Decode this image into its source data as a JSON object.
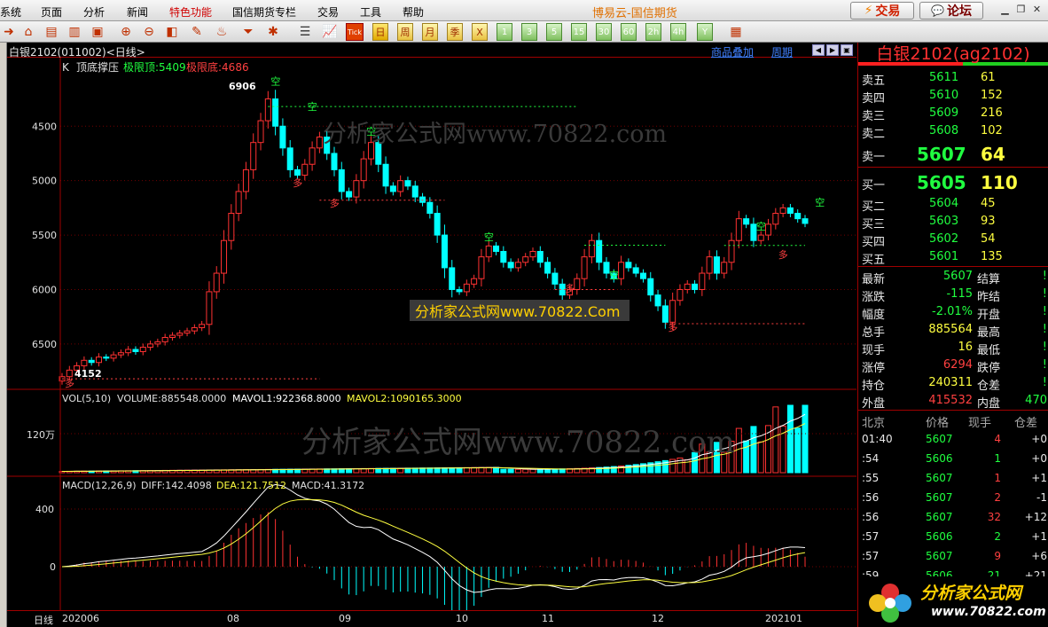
{
  "menubar": {
    "items": [
      {
        "label": "系统",
        "red": false
      },
      {
        "label": "页面",
        "red": false
      },
      {
        "label": "分析",
        "red": false
      },
      {
        "label": "新闻",
        "red": false
      },
      {
        "label": "特色功能",
        "red": true
      },
      {
        "label": "国信期货专栏",
        "red": false
      },
      {
        "label": "交易",
        "red": false
      },
      {
        "label": "工具",
        "red": false
      },
      {
        "label": "帮助",
        "red": false
      }
    ],
    "app_title": "博易云-国信期货",
    "trade_button": "交易",
    "forum_button": "论坛"
  },
  "toolbar": {
    "periods": [
      "日",
      "周",
      "月",
      "季",
      "X"
    ],
    "minutes": [
      "1",
      "3",
      "5",
      "15",
      "30",
      "60",
      "2h",
      "4h",
      "Y"
    ],
    "tick_label": "Tick"
  },
  "chart_header": {
    "title": "白银2102(011002)<日线>",
    "overlay_link": "商品叠加",
    "period_link": "周期"
  },
  "main_panel": {
    "indicator_name": "K",
    "indicator_label": "顶底撑压",
    "top_label": "极限顶:5409",
    "bottom_label": "极限底:4686",
    "high_label": "6906",
    "low_label": "4152",
    "watermark_1": "分析家公式网www.70822.com",
    "watermark_box": "分析家公式网www.70822.Com",
    "y_ticks": [
      "6500",
      "6000",
      "5500",
      "5000",
      "4500"
    ],
    "mark_kong": "空",
    "mark_duo": "多"
  },
  "volume_panel": {
    "title": "VOL(5,10)",
    "volume": "VOLUME:885548.0000",
    "mavol1": "MAVOL1:922368.8000",
    "mavol2": "MAVOL2:1090165.3000",
    "y_tick": "120万",
    "watermark": "分析家公式网www.70822.com"
  },
  "macd_panel": {
    "title": "MACD(12,26,9)",
    "diff": "DIFF:142.4098",
    "dea": "DEA:121.7512",
    "macd": "MACD:41.3172",
    "y_ticks": [
      "400",
      "0"
    ]
  },
  "x_axis": {
    "period_label": "日线",
    "labels": [
      "202006",
      "08",
      "09",
      "10",
      "11",
      "12",
      "202101"
    ]
  },
  "chart_data": {
    "type": "candlestick",
    "y_range": [
      4100,
      6950
    ],
    "x_labels": [
      "202006",
      "08",
      "09",
      "10",
      "11",
      "12",
      "202101"
    ],
    "key_levels": {
      "high": 6906,
      "low": 4152,
      "extreme_top": 5409,
      "extreme_bottom": 4686
    },
    "y_ticks": [
      4500,
      5000,
      5500,
      6000,
      6500
    ],
    "close_approx": [
      4200,
      4260,
      4300,
      4350,
      4330,
      4380,
      4370,
      4400,
      4420,
      4450,
      4430,
      4470,
      4500,
      4520,
      4560,
      4580,
      4600,
      4620,
      4650,
      4680,
      4980,
      5150,
      5450,
      5700,
      5900,
      6100,
      6350,
      6550,
      6750,
      6500,
      6300,
      6100,
      6050,
      6150,
      6300,
      6400,
      6250,
      6100,
      5900,
      5850,
      6000,
      6200,
      6350,
      6150,
      5950,
      5900,
      6000,
      5950,
      5850,
      5800,
      5700,
      5500,
      5200,
      5000,
      4980,
      5050,
      5100,
      5300,
      5400,
      5350,
      5250,
      5200,
      5250,
      5300,
      5350,
      5250,
      5150,
      5050,
      4950,
      5000,
      5100,
      5300,
      5450,
      5250,
      5150,
      5100,
      5250,
      5200,
      5150,
      5100,
      4950,
      4850,
      4700,
      4900,
      5000,
      5050,
      5000,
      5150,
      5300,
      5150,
      5250,
      5450,
      5650,
      5600,
      5450,
      5500,
      5600,
      5700,
      5750,
      5700,
      5650,
      5607
    ],
    "volume_label": "VOLUME:885548.0000",
    "macd": {
      "diff": 142.4098,
      "dea": 121.7512,
      "macd": 41.3172,
      "y_ticks": [
        0,
        400
      ]
    }
  },
  "quote_panel": {
    "title": "白银2102(ag2102)",
    "asks": [
      {
        "label": "卖五",
        "price": "5611",
        "vol": "61"
      },
      {
        "label": "卖四",
        "price": "5610",
        "vol": "152"
      },
      {
        "label": "卖三",
        "price": "5609",
        "vol": "216"
      },
      {
        "label": "卖二",
        "price": "5608",
        "vol": "102"
      }
    ],
    "ask1": {
      "label": "卖一",
      "price": "5607",
      "vol": "64"
    },
    "bid1": {
      "label": "买一",
      "price": "5605",
      "vol": "110"
    },
    "bids": [
      {
        "label": "买二",
        "price": "5604",
        "vol": "45"
      },
      {
        "label": "买三",
        "price": "5603",
        "vol": "93"
      },
      {
        "label": "买四",
        "price": "5602",
        "vol": "54"
      },
      {
        "label": "买五",
        "price": "5601",
        "vol": "135"
      }
    ],
    "stats": [
      {
        "l1": "最新",
        "v1": "5607",
        "c1": "grn",
        "l2": "结算",
        "v2": "!"
      },
      {
        "l1": "涨跌",
        "v1": "-115",
        "c1": "grn",
        "l2": "昨结",
        "v2": "!"
      },
      {
        "l1": "幅度",
        "v1": "-2.01%",
        "c1": "grn",
        "l2": "开盘",
        "v2": "!"
      },
      {
        "l1": "总手",
        "v1": "885564",
        "c1": "yel",
        "l2": "最高",
        "v2": "!"
      },
      {
        "l1": "现手",
        "v1": "16",
        "c1": "yel",
        "l2": "最低",
        "v2": "!"
      },
      {
        "l1": "涨停",
        "v1": "6294",
        "c1": "red2",
        "l2": "跌停",
        "v2": "!"
      },
      {
        "l1": "持仓",
        "v1": "240311",
        "c1": "yel",
        "l2": "仓差",
        "v2": "!"
      },
      {
        "l1": "外盘",
        "v1": "415532",
        "c1": "red2",
        "l2": "内盘",
        "v2": "470"
      }
    ],
    "ticks_header": {
      "c1": "北京",
      "c2": "价格",
      "c3": "现手",
      "c4": "仓差"
    },
    "ticks": [
      {
        "time": "01:40",
        "price": "5607",
        "vol": "4",
        "vc": "red2",
        "chg": "+0"
      },
      {
        "time": ":54",
        "price": "5606",
        "vol": "1",
        "vc": "grn",
        "chg": "+0"
      },
      {
        "time": ":55",
        "price": "5607",
        "vol": "1",
        "vc": "red2",
        "chg": "+1"
      },
      {
        "time": ":56",
        "price": "5607",
        "vol": "2",
        "vc": "red2",
        "chg": "-1"
      },
      {
        "time": ":56",
        "price": "5607",
        "vol": "32",
        "vc": "red2",
        "chg": "+12"
      },
      {
        "time": ":57",
        "price": "5606",
        "vol": "2",
        "vc": "grn",
        "chg": "+1"
      },
      {
        "time": ":57",
        "price": "5607",
        "vol": "9",
        "vc": "red2",
        "chg": "+6"
      },
      {
        "time": ":59",
        "price": "5606",
        "vol": "21",
        "vc": "grn",
        "chg": "+21"
      }
    ]
  },
  "footer_logo": {
    "name": "分析家公式网",
    "url": "www.70822.com"
  }
}
